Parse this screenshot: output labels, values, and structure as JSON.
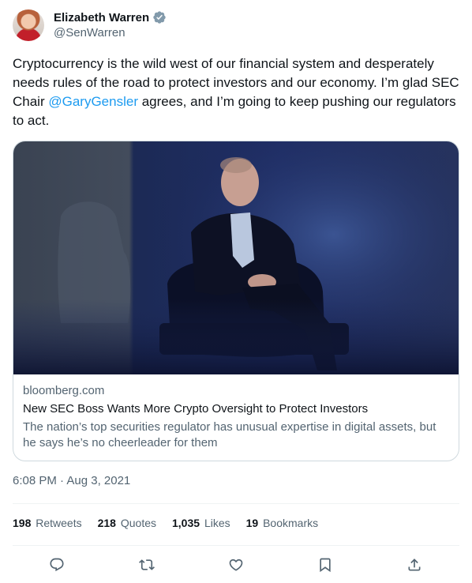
{
  "author": {
    "name": "Elizabeth Warren",
    "handle": "@SenWarren",
    "verified_icon": "verified-badge-icon"
  },
  "tweet": {
    "text_before": "Cryptocurrency is the wild west of our financial system and desperately needs rules of the road to protect investors and our economy. I’m glad SEC Chair ",
    "mention": "@GaryGensler",
    "text_after": " agrees, and I’m going to keep pushing our regulators to act."
  },
  "card": {
    "domain": "bloomberg.com",
    "title": "New SEC Boss Wants More Crypto Oversight to Protect Investors",
    "description": "The nation’s top securities regulator has unusual expertise in digital assets, but he says he’s no cheerleader for them"
  },
  "timestamp": "6:08 PM · Aug 3, 2021",
  "stats": [
    {
      "count": "198",
      "label": "Retweets"
    },
    {
      "count": "218",
      "label": "Quotes"
    },
    {
      "count": "1,035",
      "label": "Likes"
    },
    {
      "count": "19",
      "label": "Bookmarks"
    }
  ],
  "actions": [
    "reply-icon",
    "retweet-icon",
    "like-icon",
    "bookmark-icon",
    "share-icon"
  ],
  "colors": {
    "text": "#0f1419",
    "secondary": "#536471",
    "link": "#1d9bf0",
    "border": "#cfd9de"
  }
}
